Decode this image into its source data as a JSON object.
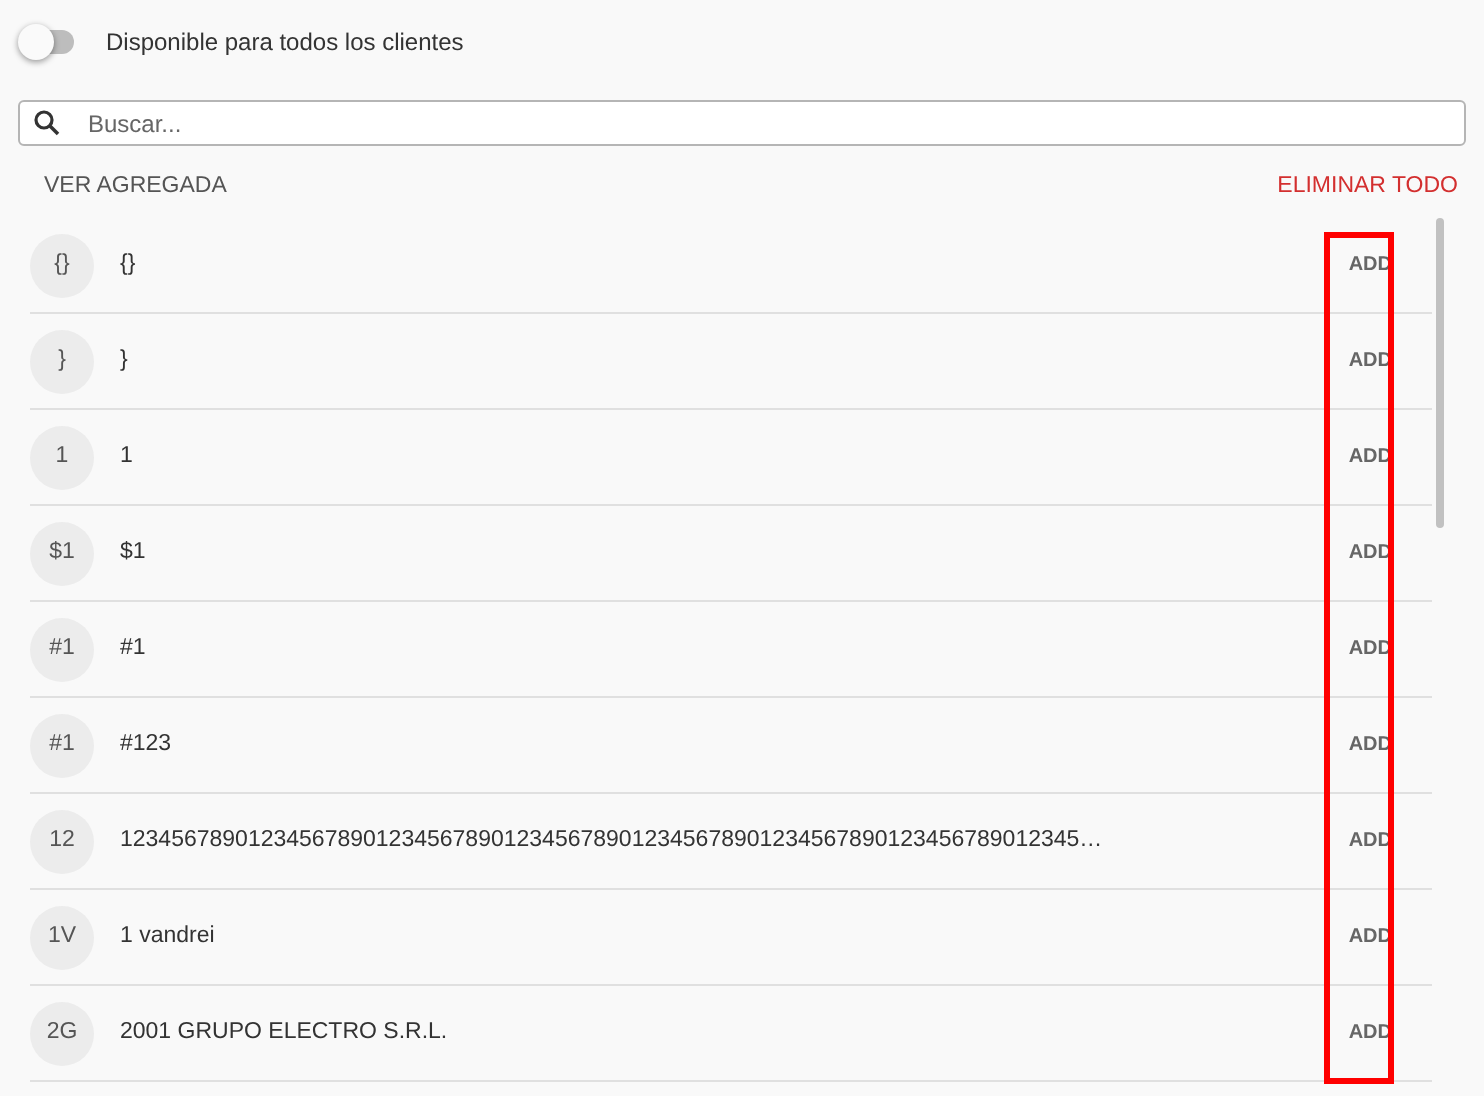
{
  "toggle": {
    "label": "Disponible para todos los clientes",
    "on": false
  },
  "search": {
    "placeholder": "Buscar..."
  },
  "header": {
    "view_link": "VER AGREGADA",
    "clear_link": "ELIMINAR TODO"
  },
  "add_column_highlighted": true,
  "items": [
    {
      "initials": "{}",
      "name": "{}",
      "action": "ADD"
    },
    {
      "initials": "}",
      "name": "}",
      "action": "ADD"
    },
    {
      "initials": "1",
      "name": "1",
      "action": "ADD"
    },
    {
      "initials": "$1",
      "name": "$1",
      "action": "ADD"
    },
    {
      "initials": "#1",
      "name": "#1",
      "action": "ADD"
    },
    {
      "initials": "#1",
      "name": "#123",
      "action": "ADD"
    },
    {
      "initials": "12",
      "name": "123456789012345678901234567890123456789012345678901234567890123456789012345…",
      "action": "ADD"
    },
    {
      "initials": "1V",
      "name": "1 vandrei",
      "action": "ADD"
    },
    {
      "initials": "2G",
      "name": "2001 GRUPO ELECTRO S.R.L.",
      "action": "ADD"
    }
  ]
}
